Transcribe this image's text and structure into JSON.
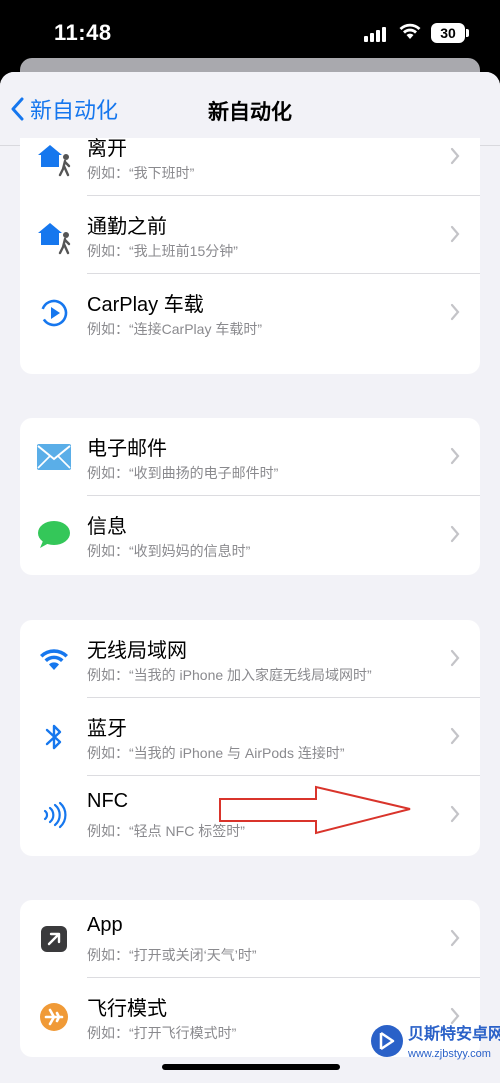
{
  "status_bar": {
    "time": "11:48",
    "battery": "30"
  },
  "nav": {
    "back_label": "新自动化",
    "title": "新自动化"
  },
  "groups": [
    {
      "rows": [
        {
          "title": "离开",
          "subtitle": "例如：“我下班时”",
          "icon": "home-leave-icon"
        },
        {
          "title": "通勤之前",
          "subtitle": "例如：“我上班前15分钟”",
          "icon": "home-commute-icon"
        },
        {
          "title": "CarPlay 车载",
          "subtitle": "例如：“连接CarPlay 车载时”",
          "icon": "carplay-icon"
        }
      ]
    },
    {
      "rows": [
        {
          "title": "电子邮件",
          "subtitle": "例如：“收到曲扬的电子邮件时”",
          "icon": "mail-icon"
        },
        {
          "title": "信息",
          "subtitle": "例如：“收到妈妈的信息时”",
          "icon": "message-icon"
        }
      ]
    },
    {
      "rows": [
        {
          "title": "无线局域网",
          "subtitle": "例如：“当我的 iPhone 加入家庭无线局域网时”",
          "icon": "wifi-icon"
        },
        {
          "title": "蓝牙",
          "subtitle": "例如：“当我的 iPhone 与 AirPods 连接时”",
          "icon": "bluetooth-icon"
        },
        {
          "title": "NFC",
          "subtitle": "例如：“轻点 NFC 标签时”",
          "icon": "nfc-icon"
        }
      ]
    },
    {
      "rows": [
        {
          "title": "App",
          "subtitle": "例如：“打开或关闭‘天气’时”",
          "icon": "app-icon"
        },
        {
          "title": "飞行模式",
          "subtitle": "例如：“打开飞行模式时”",
          "icon": "airplane-icon"
        }
      ]
    }
  ],
  "watermark": {
    "line1": "贝斯特安卓网",
    "line2": "www.zjbstyy.com"
  },
  "colors": {
    "accent": "#1677ee",
    "background": "#f2f2f7",
    "annotation": "#d9342b"
  }
}
